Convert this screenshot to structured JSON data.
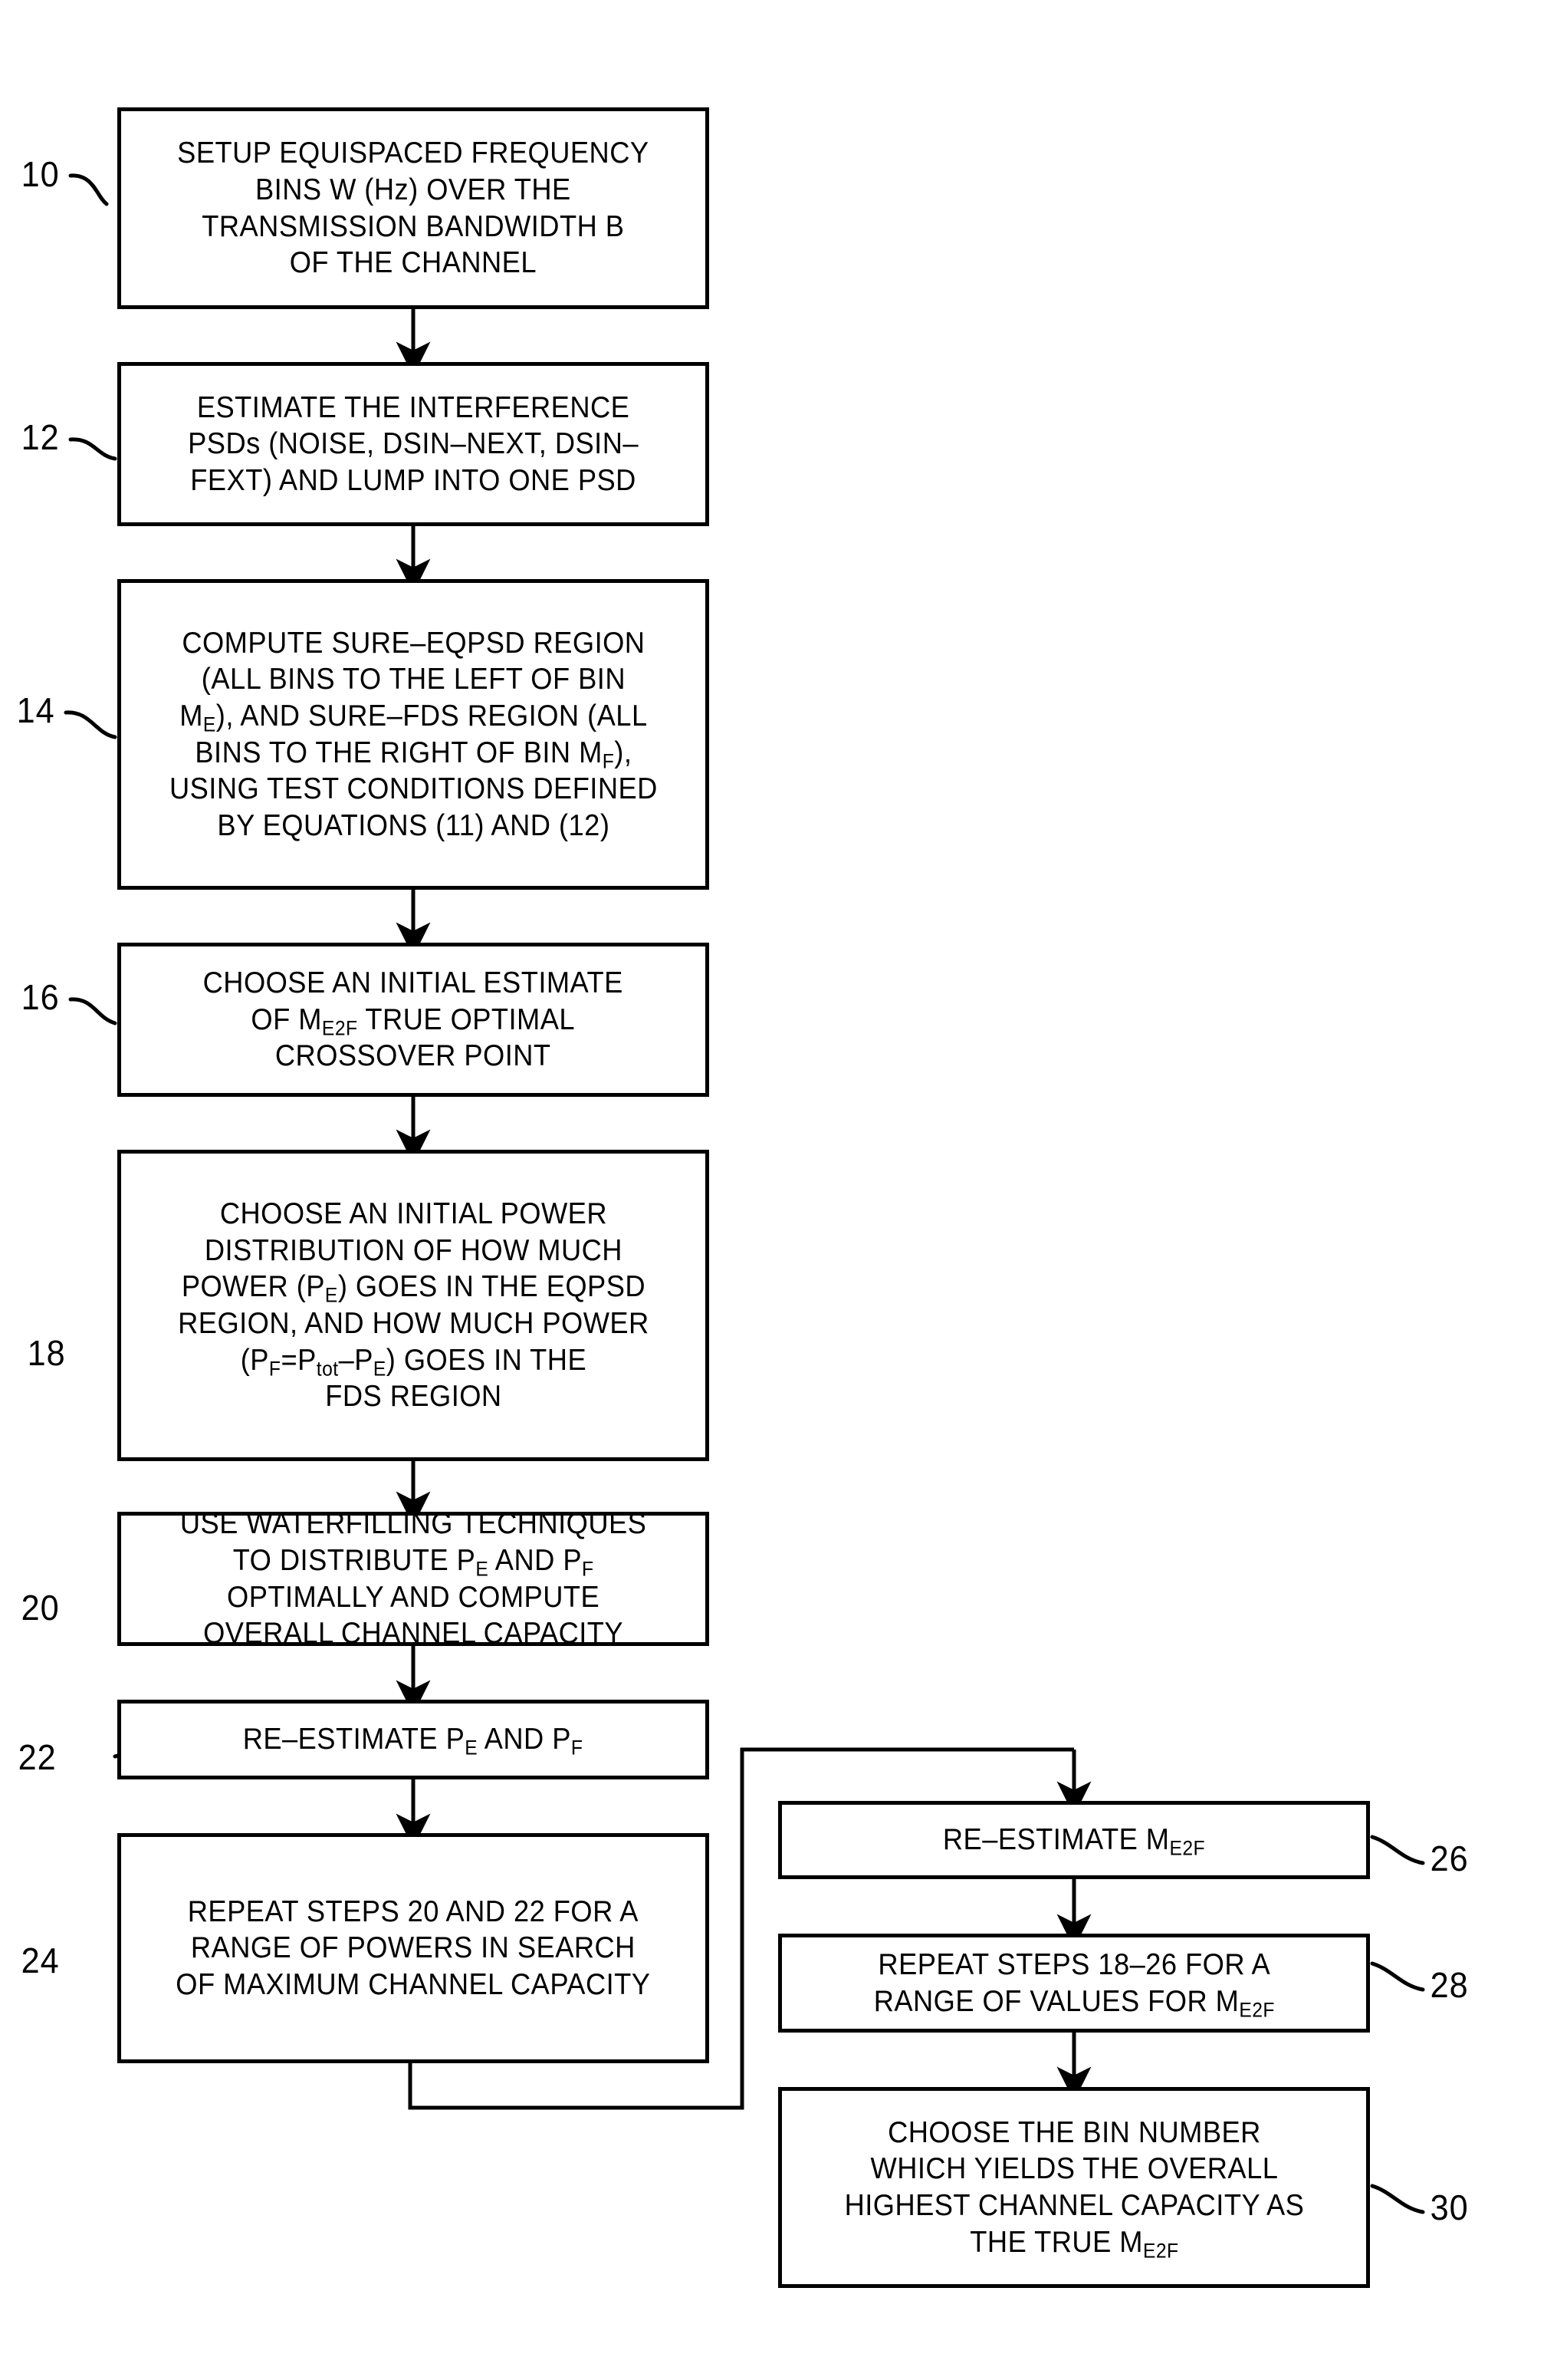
{
  "figure": {
    "type": "patent-flowchart",
    "background_color": "#ffffff",
    "line_color": "#000000"
  },
  "boxes": [
    {
      "ref": "10",
      "text": "SETUP EQUISPACED FREQUENCY\nBINS W (Hz) OVER THE\nTRANSMISSION BANDWIDTH B\nOF THE CHANNEL"
    },
    {
      "ref": "12",
      "text": "ESTIMATE THE INTERFERENCE\nPSDs (NOISE, DSIN-NEXT, DSIN-\nFEXT) AND LUMP INTO ONE PSD"
    },
    {
      "ref": "14",
      "text": "COMPUTE SURE-EQPSD REGION\n(ALL BINS TO THE LEFT OF BIN\nME), AND SURE-FDS REGION (ALL\nBINS TO THE RIGHT OF BIN MF),\nUSING TEST CONDITIONS DEFINED\nBY EQUATIONS (11) AND (12)"
    },
    {
      "ref": "16",
      "text": "CHOOSE AN INITIAL ESTIMATE\nOF ME2F TRUE OPTIMAL\nCROSSOVER POINT"
    },
    {
      "ref": "18",
      "text": "CHOOSE AN INITIAL POWER\nDISTRIBUTION OF HOW MUCH\nPOWER (PE) GOES IN THE EQPSD\nREGION, AND HOW MUCH POWER\n(PF=Ptot-PE) GOES IN THE\nFDS REGION"
    },
    {
      "ref": "20",
      "text": "USE WATERFILLING TECHNIQUES\nTO DISTRIBUTE PE AND PF\nOPTIMALLY AND COMPUTE\nOVERALL CHANNEL CAPACITY"
    },
    {
      "ref": "22",
      "text": "RE-ESTIMATE PE AND PF"
    },
    {
      "ref": "24",
      "text": "REPEAT STEPS 20 AND 22 FOR A\nRANGE OF POWERS IN SEARCH\nOF MAXIMUM CHANNEL CAPACITY"
    },
    {
      "ref": "26",
      "text": "RE-ESTIMATE ME2F"
    },
    {
      "ref": "28",
      "text": "REPEAT STEPS 18-26 FOR A\nRANGE OF VALUES FOR ME2F"
    },
    {
      "ref": "30",
      "text": "CHOOSE THE BIN NUMBER\nWHICH YIELDS THE OVERALL\nHIGHEST CHANNEL CAPACITY AS\nTHE TRUE ME2F"
    }
  ],
  "box_html": {
    "b10": "SETUP EQUISPACED FREQUENCY<br>BINS W (Hz) OVER THE<br>TRANSMISSION BANDWIDTH B<br>OF THE CHANNEL",
    "b12": "ESTIMATE THE INTERFERENCE<br>PSDs (NOISE, DSIN&#8211;NEXT, DSIN&#8211;<br>FEXT) AND LUMP INTO ONE PSD",
    "b14": "COMPUTE SURE&#8211;EQPSD REGION<br>(ALL BINS TO THE LEFT OF BIN<br>M<sub>E</sub>), AND SURE&#8211;FDS REGION (ALL<br>BINS TO THE RIGHT OF BIN M<sub>F</sub>),<br>USING TEST CONDITIONS DEFINED<br>BY EQUATIONS (11) AND (12)",
    "b16": "CHOOSE AN INITIAL ESTIMATE<br>OF M<sub>E2F</sub> TRUE OPTIMAL<br>CROSSOVER POINT",
    "b18": "CHOOSE AN INITIAL POWER<br>DISTRIBUTION OF HOW MUCH<br>POWER (P<sub>E</sub>) GOES IN THE EQPSD<br>REGION, AND HOW MUCH POWER<br>(P<sub>F</sub>=P<sub>tot</sub>&#8211;P<sub>E</sub>) GOES IN THE<br>FDS REGION",
    "b20": "USE WATERFILLING TECHNIQUES<br>TO DISTRIBUTE P<sub>E</sub> AND P<sub>F</sub><br>OPTIMALLY AND COMPUTE<br>OVERALL CHANNEL CAPACITY",
    "b22": "RE&#8211;ESTIMATE P<sub>E</sub> AND P<sub>F</sub>",
    "b24": "REPEAT STEPS 20 AND 22 FOR A<br>RANGE OF POWERS IN SEARCH<br>OF MAXIMUM CHANNEL CAPACITY",
    "b26": "RE&#8211;ESTIMATE M<sub>E2F</sub>",
    "b28": "REPEAT STEPS 18&#8211;26 FOR A<br>RANGE OF VALUES FOR M<sub>E2F</sub>",
    "b30": "CHOOSE THE BIN NUMBER<br>WHICH YIELDS THE OVERALL<br>HIGHEST CHANNEL CAPACITY AS<br>THE TRUE M<sub>E2F</sub>"
  },
  "refs": {
    "r10": "10",
    "r12": "12",
    "r14": "14",
    "r16": "16",
    "r18": "18",
    "r20": "20",
    "r22": "22",
    "r24": "24",
    "r26": "26",
    "r28": "28",
    "r30": "30"
  }
}
